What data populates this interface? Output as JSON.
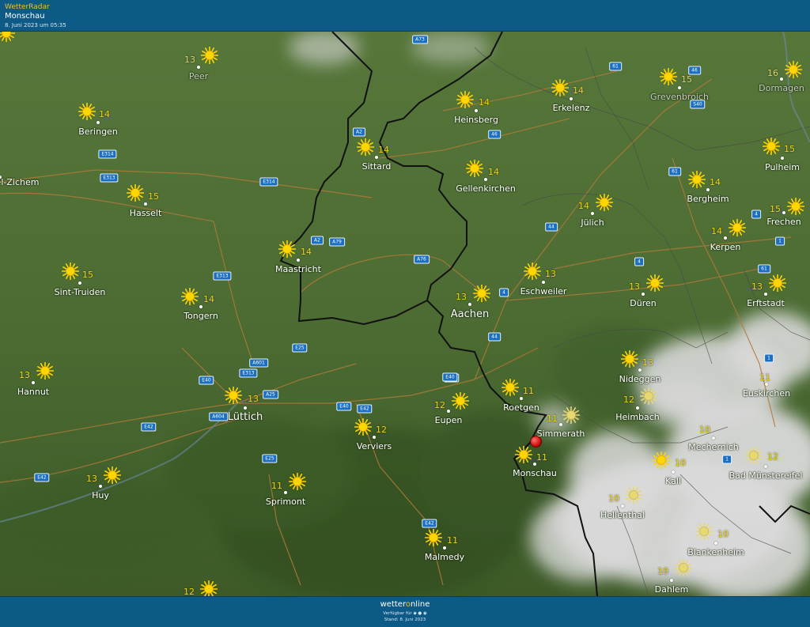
{
  "header": {
    "app_name": "WetterRadar",
    "station": "Monschau",
    "timestamp": "8. Juni 2023 um 05:35"
  },
  "footer": {
    "brand_a": "wetter",
    "brand_b": "o",
    "brand_c": "nline",
    "available": "Verfügbar für",
    "store_icons": "app-store-icons",
    "stand": "Stand: 8. Juni 2023"
  },
  "colors": {
    "header_bg": "#0e5a87",
    "accent": "#f0c020",
    "map_green": "#4f6e35",
    "cloud": "#d8d8d8"
  },
  "map": {
    "cities": [
      {
        "name": "Peer",
        "temp": "13",
        "icon": "sun-icon",
        "dim": true
      },
      {
        "name": "Beringen",
        "temp": "14",
        "icon": "sun-icon"
      },
      {
        "name": "el-Zichem",
        "temp": "",
        "icon": ""
      },
      {
        "name": "Hasselt",
        "temp": "15",
        "icon": "sun-icon"
      },
      {
        "name": "Sint-Truiden",
        "temp": "15",
        "icon": "sun-icon"
      },
      {
        "name": "Tongern",
        "temp": "14",
        "icon": "sun-icon"
      },
      {
        "name": "Hannut",
        "temp": "13",
        "icon": "sun-icon"
      },
      {
        "name": "Lüttich",
        "temp": "13",
        "icon": "sun-icon",
        "big": true
      },
      {
        "name": "Huy",
        "temp": "13",
        "icon": "sun-icon"
      },
      {
        "name": "Sprimont",
        "temp": "11",
        "icon": "sun-icon"
      },
      {
        "name": "Verviers",
        "temp": "12",
        "icon": "sun-icon"
      },
      {
        "name": "Malmedy",
        "temp": "11",
        "icon": "sun-icon"
      },
      {
        "name": "Eupen",
        "temp": "12",
        "icon": "sun-icon"
      },
      {
        "name": "Maastricht",
        "temp": "14",
        "icon": "sun-icon"
      },
      {
        "name": "Sittard",
        "temp": "14",
        "icon": "sun-icon"
      },
      {
        "name": "Heinsberg",
        "temp": "14",
        "icon": "sun-icon"
      },
      {
        "name": "Gellenkirchen",
        "temp": "14",
        "icon": "sun-icon"
      },
      {
        "name": "Erkelenz",
        "temp": "14",
        "icon": "sun-icon"
      },
      {
        "name": "Aachen",
        "temp": "13",
        "icon": "sun-icon",
        "big": true
      },
      {
        "name": "Eschweiler",
        "temp": "13",
        "icon": "sun-icon"
      },
      {
        "name": "Jülich",
        "temp": "14",
        "icon": "sun-icon"
      },
      {
        "name": "Roetgen",
        "temp": "11",
        "icon": "sun-icon"
      },
      {
        "name": "Simmerath",
        "temp": "11",
        "icon": "sun-dim-icon"
      },
      {
        "name": "Monschau",
        "temp": "11",
        "icon": "sun-icon"
      },
      {
        "name": "Grevenbroich",
        "temp": "15",
        "icon": "sun-icon",
        "dim": true
      },
      {
        "name": "Dormagen",
        "temp": "16",
        "icon": "sun-icon",
        "dim": true
      },
      {
        "name": "Bergheim",
        "temp": "14",
        "icon": "sun-icon"
      },
      {
        "name": "Pulheim",
        "temp": "15",
        "icon": "sun-icon"
      },
      {
        "name": "Frechen",
        "temp": "15",
        "icon": "sun-icon"
      },
      {
        "name": "Kerpen",
        "temp": "14",
        "icon": "sun-icon"
      },
      {
        "name": "Düren",
        "temp": "13",
        "icon": "sun-icon"
      },
      {
        "name": "Erftstadt",
        "temp": "13",
        "icon": "sun-icon"
      },
      {
        "name": "Nideggen",
        "temp": "13",
        "icon": "sun-icon"
      },
      {
        "name": "Heimbach",
        "temp": "12",
        "icon": "sun-dim-icon"
      },
      {
        "name": "Euskirchen",
        "temp": "11",
        "icon": "sun-dim-icon"
      },
      {
        "name": "Mechernich",
        "temp": "10",
        "icon": ""
      },
      {
        "name": "Kall",
        "temp": "10",
        "icon": "sun-icon"
      },
      {
        "name": "Bad Münstereifel",
        "temp": "12",
        "icon": "sun-dim-icon"
      },
      {
        "name": "Hellenthal",
        "temp": "10",
        "icon": "sun-dim-icon"
      },
      {
        "name": "Blankenheim",
        "temp": "10",
        "icon": "sun-dim-icon"
      },
      {
        "name": "Dahlem",
        "temp": "10",
        "icon": "sun-dim-icon"
      },
      {
        "name": "",
        "temp": "12",
        "icon": "sun-icon"
      },
      {
        "name": "",
        "temp": "",
        "icon": "sun-icon"
      }
    ],
    "roads": [
      "A73",
      "61",
      "46",
      "S40",
      "A2",
      "46",
      "E314",
      "E313",
      "E314",
      "61",
      "A2",
      "A79",
      "A76",
      "4",
      "44",
      "4",
      "1",
      "E313",
      "4",
      "61",
      "E25",
      "44",
      "E40",
      "A601",
      "E313",
      "E40",
      "A25",
      "E40",
      "E42",
      "A604",
      "E42",
      "E25",
      "E42",
      "E42",
      "E40",
      "1",
      "1"
    ]
  }
}
